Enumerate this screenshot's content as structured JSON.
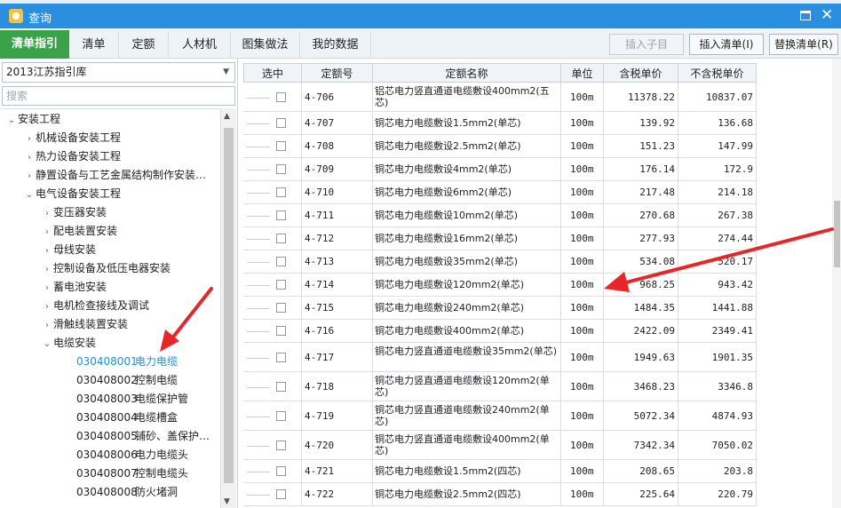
{
  "window": {
    "title": "查询",
    "app_icon": "app-logo-icon",
    "maximize_icon": "maximize-icon",
    "close_icon": "close-icon",
    "close_glyph": "✕"
  },
  "tabs": [
    "清单指引",
    "清单",
    "定额",
    "人材机",
    "图集做法",
    "我的数据"
  ],
  "active_tab": "清单指引",
  "actions": {
    "insert_child": "插入子目",
    "insert_list": "插入清单(I)",
    "replace_list": "替换清单(R)"
  },
  "library": {
    "selected": "2013江苏指引库"
  },
  "search": {
    "placeholder": "搜索"
  },
  "tree": [
    {
      "level": 0,
      "expanded": true,
      "label": "安装工程"
    },
    {
      "level": 1,
      "expanded": false,
      "label": "机械设备安装工程"
    },
    {
      "level": 1,
      "expanded": false,
      "label": "热力设备安装工程"
    },
    {
      "level": 1,
      "expanded": false,
      "label": "静置设备与工艺金属结构制作安装…"
    },
    {
      "level": 1,
      "expanded": true,
      "label": "电气设备安装工程"
    },
    {
      "level": 2,
      "expanded": false,
      "label": "变压器安装"
    },
    {
      "level": 2,
      "expanded": false,
      "label": "配电装置安装"
    },
    {
      "level": 2,
      "expanded": false,
      "label": "母线安装"
    },
    {
      "level": 2,
      "expanded": false,
      "label": "控制设备及低压电器安装"
    },
    {
      "level": 2,
      "expanded": false,
      "label": "蓄电池安装"
    },
    {
      "level": 2,
      "expanded": false,
      "label": "电机检查接线及调试"
    },
    {
      "level": 2,
      "expanded": false,
      "label": "滑触线装置安装"
    },
    {
      "level": 2,
      "expanded": true,
      "label": "电缆安装"
    },
    {
      "level": 3,
      "code": "030408001",
      "label": "电力电缆",
      "selected": true
    },
    {
      "level": 3,
      "code": "030408002",
      "label": "控制电缆"
    },
    {
      "level": 3,
      "code": "030408003",
      "label": "电缆保护管"
    },
    {
      "level": 3,
      "code": "030408004",
      "label": "电缆槽盒"
    },
    {
      "level": 3,
      "code": "030408005",
      "label": "铺砂、盖保护…"
    },
    {
      "level": 3,
      "code": "030408006",
      "label": "电力电缆头"
    },
    {
      "level": 3,
      "code": "030408007",
      "label": "控制电缆头"
    },
    {
      "level": 3,
      "code": "030408008",
      "label": "防火堵洞"
    }
  ],
  "grid": {
    "headers": [
      "选中",
      "定额号",
      "定额名称",
      "单位",
      "含税单价",
      "不含税单价"
    ],
    "rows": [
      {
        "code": "4-706",
        "name": "铝芯电力竖直通道电缆敷设400mm2(五芯)",
        "unit": "100m",
        "tax": "11378.22",
        "notax": "10837.07",
        "tall": true
      },
      {
        "code": "4-707",
        "name": "铜芯电力电缆敷设1.5mm2(单芯)",
        "unit": "100m",
        "tax": "139.92",
        "notax": "136.68"
      },
      {
        "code": "4-708",
        "name": "铜芯电力电缆敷设2.5mm2(单芯)",
        "unit": "100m",
        "tax": "151.23",
        "notax": "147.99"
      },
      {
        "code": "4-709",
        "name": "铜芯电力电缆敷设4mm2(单芯)",
        "unit": "100m",
        "tax": "176.14",
        "notax": "172.9"
      },
      {
        "code": "4-710",
        "name": "铜芯电力电缆敷设6mm2(单芯)",
        "unit": "100m",
        "tax": "217.48",
        "notax": "214.18"
      },
      {
        "code": "4-711",
        "name": "铜芯电力电缆敷设10mm2(单芯)",
        "unit": "100m",
        "tax": "270.68",
        "notax": "267.38"
      },
      {
        "code": "4-712",
        "name": "铜芯电力电缆敷设16mm2(单芯)",
        "unit": "100m",
        "tax": "277.93",
        "notax": "274.44"
      },
      {
        "code": "4-713",
        "name": "铜芯电力电缆敷设35mm2(单芯)",
        "unit": "100m",
        "tax": "534.08",
        "notax": "520.17"
      },
      {
        "code": "4-714",
        "name": "铜芯电力电缆敷设120mm2(单芯)",
        "unit": "100m",
        "tax": "968.25",
        "notax": "943.42"
      },
      {
        "code": "4-715",
        "name": "铜芯电力电缆敷设240mm2(单芯)",
        "unit": "100m",
        "tax": "1484.35",
        "notax": "1441.88"
      },
      {
        "code": "4-716",
        "name": "铜芯电力电缆敷设400mm2(单芯)",
        "unit": "100m",
        "tax": "2422.09",
        "notax": "2349.41"
      },
      {
        "code": "4-717",
        "name": "铜芯电力竖直通道电缆敷设35mm2(单芯)",
        "unit": "100m",
        "tax": "1949.63",
        "notax": "1901.35",
        "tall": true
      },
      {
        "code": "4-718",
        "name": "铜芯电力竖直通道电缆敷设120mm2(单芯)",
        "unit": "100m",
        "tax": "3468.23",
        "notax": "3346.8",
        "tall": true
      },
      {
        "code": "4-719",
        "name": "铜芯电力竖直通道电缆敷设240mm2(单芯)",
        "unit": "100m",
        "tax": "5072.34",
        "notax": "4874.93",
        "tall": true
      },
      {
        "code": "4-720",
        "name": "铜芯电力竖直通道电缆敷设400mm2(单芯)",
        "unit": "100m",
        "tax": "7342.34",
        "notax": "7050.02",
        "tall": true
      },
      {
        "code": "4-721",
        "name": "铜芯电力电缆敷设1.5mm2(四芯)",
        "unit": "100m",
        "tax": "208.65",
        "notax": "203.8"
      },
      {
        "code": "4-722",
        "name": "铜芯电力电缆敷设2.5mm2(四芯)",
        "unit": "100m",
        "tax": "225.64",
        "notax": "220.79"
      }
    ]
  },
  "colors": {
    "titlebar": "#2b8fe0",
    "active_tab": "#3aa34a",
    "annotation_arrow": "#e8262a",
    "selected_item": "#1d8fe3"
  }
}
